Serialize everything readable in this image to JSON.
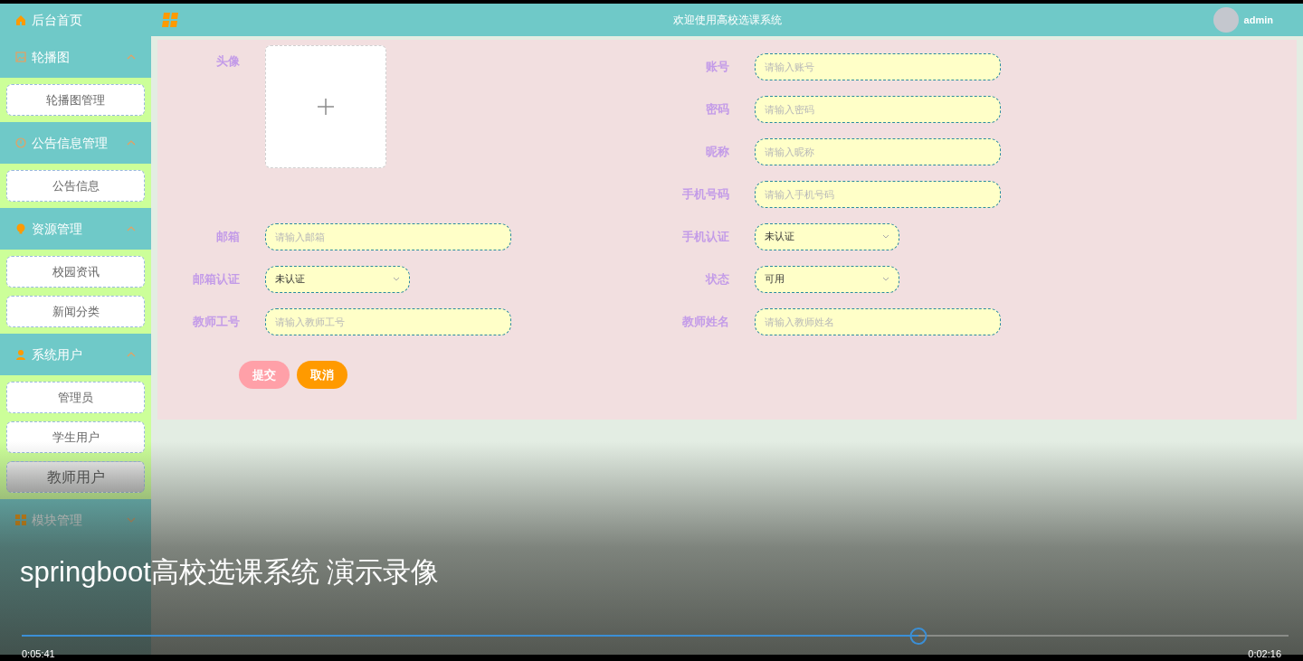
{
  "header": {
    "title": "欢迎使用高校选课系统",
    "user": "admin"
  },
  "sidebar": {
    "items": [
      {
        "label": "后台首页"
      },
      {
        "label": "轮播图",
        "expanded": true,
        "children": [
          {
            "label": "轮播图管理",
            "selected": false
          }
        ]
      },
      {
        "label": "公告信息管理",
        "expanded": true,
        "children": [
          {
            "label": "公告信息",
            "selected": false
          }
        ]
      },
      {
        "label": "资源管理",
        "expanded": true,
        "children": [
          {
            "label": "校园资讯",
            "selected": false
          },
          {
            "label": "新闻分类",
            "selected": false
          }
        ]
      },
      {
        "label": "系统用户",
        "expanded": true,
        "children": [
          {
            "label": "管理员",
            "selected": false
          },
          {
            "label": "学生用户",
            "selected": false
          },
          {
            "label": "教师用户",
            "selected": true
          }
        ]
      },
      {
        "label": "模块管理",
        "expanded": false
      }
    ]
  },
  "form": {
    "left": [
      {
        "kind": "upload",
        "label": "头像"
      },
      {
        "kind": "input",
        "label": "邮箱",
        "placeholder": "请输入邮箱"
      },
      {
        "kind": "select",
        "label": "邮箱认证",
        "value": "未认证"
      },
      {
        "kind": "input",
        "label": "教师工号",
        "placeholder": "请输入教师工号"
      }
    ],
    "right": [
      {
        "kind": "input",
        "label": "账号",
        "placeholder": "请输入账号"
      },
      {
        "kind": "input",
        "label": "密码",
        "placeholder": "请输入密码"
      },
      {
        "kind": "input",
        "label": "昵称",
        "placeholder": "请输入昵称"
      },
      {
        "kind": "input",
        "label": "手机号码",
        "placeholder": "请输入手机号码"
      },
      {
        "kind": "select",
        "label": "手机认证",
        "value": "未认证"
      },
      {
        "kind": "select",
        "label": "状态",
        "value": "可用"
      },
      {
        "kind": "input",
        "label": "教师姓名",
        "placeholder": "请输入教师姓名"
      }
    ],
    "buttons": [
      {
        "label": "提交",
        "kind": "primary"
      },
      {
        "label": "取消",
        "kind": "cancel"
      }
    ]
  },
  "video": {
    "caption": "springboot高校选课系统 演示录像",
    "level": 0.708,
    "elapsed": "0:05:41",
    "remaining": "0:02:16"
  }
}
